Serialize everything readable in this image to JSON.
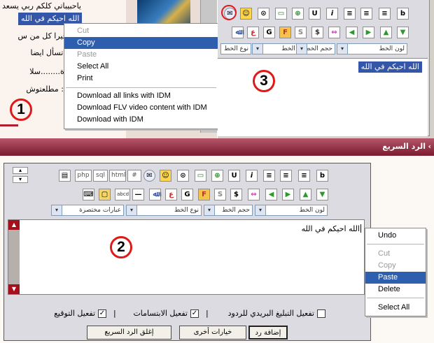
{
  "panel1": {
    "lines": [
      "ياحبيباتي كلكم ربي يسعد",
      "الله احيكم في الله",
      "الله خيرا كل من س",
      "ن لم تسأل ايضا",
      "ياسارة........سلا",
      "وغادة: مطلعتوش"
    ],
    "selected_text": "الله احيكم في الله",
    "context_menu": [
      {
        "label": "Cut",
        "state": "disabled"
      },
      {
        "label": "Copy",
        "state": "highlighted"
      },
      {
        "label": "Paste",
        "state": "disabled"
      },
      {
        "label": "Select All",
        "state": "normal"
      },
      {
        "label": "Print",
        "state": "normal"
      },
      {
        "label": "Download all links with IDM",
        "state": "normal"
      },
      {
        "label": "Download FLV video content with IDM",
        "state": "normal"
      },
      {
        "label": "Download with IDM",
        "state": "normal"
      }
    ],
    "step": "1"
  },
  "panel3": {
    "selected_text": "الله احيكم في الله",
    "font_color_label": "لون الخط",
    "font_size_label": "حجم الخط",
    "font_type_label": "نوع الخط",
    "step": "3"
  },
  "quick_reply": {
    "title": "الرد السريع",
    "toolbar_buttons": [
      "php",
      "sql",
      "html",
      "#"
    ],
    "font_color_label": "لون الخط",
    "font_type_label": "نوع الخط",
    "font_size_label": "حجم الخط",
    "shortcuts_label": "عبارات مختصرة",
    "textarea_text": "الله احيكم في الله",
    "step": "2",
    "context_menu": [
      {
        "label": "Undo",
        "state": "normal"
      },
      {
        "label": "Cut",
        "state": "disabled"
      },
      {
        "label": "Copy",
        "state": "disabled"
      },
      {
        "label": "Paste",
        "state": "highlighted"
      },
      {
        "label": "Delete",
        "state": "normal"
      },
      {
        "label": "Select All",
        "state": "normal"
      }
    ],
    "options": {
      "signature": "تفعيل التوقيع",
      "smilies": "تفعيل الابتسامات",
      "email_notify": "تفعيل التبليغ البريدي للردود",
      "separator": "|"
    },
    "buttons": {
      "add_reply": "إضافة رد",
      "more_options": "خيارات أخرى",
      "close": "إغلق الرد السريع"
    }
  },
  "colors": {
    "highlight": "#2e5fae",
    "bar": "#8b2a3e",
    "circle": "#e01818"
  }
}
